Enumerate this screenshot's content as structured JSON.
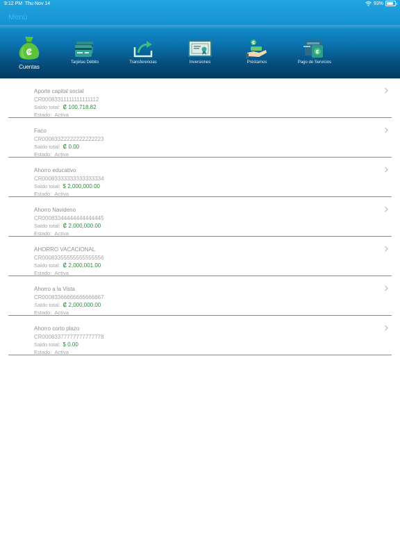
{
  "status_bar": {
    "time": "9:12 PM",
    "date": "Thu Nov 14",
    "battery": "93%"
  },
  "header": {
    "menu_label": "Menú",
    "colors": {
      "menu_link": "#3fb6ff",
      "header_top": "#22a6e2",
      "header_bottom": "#043c62"
    }
  },
  "nav": [
    {
      "label": "Cuentas",
      "icon": "money-bag-icon",
      "active": true
    },
    {
      "label": "Tarjetas Débito",
      "icon": "debit-card-icon",
      "active": false
    },
    {
      "label": "Transferencias",
      "icon": "transfer-arrow-icon",
      "active": false
    },
    {
      "label": "Inversiones",
      "icon": "certificate-icon",
      "active": false
    },
    {
      "label": "Préstamos",
      "icon": "loan-hand-icon",
      "active": false
    },
    {
      "label": "Pago de Servicios",
      "icon": "bill-payment-icon",
      "active": false
    }
  ],
  "labels": {
    "saldo": "Saldo total:",
    "estado": "Estado:"
  },
  "accounts": [
    {
      "name": "Aporte capital social",
      "number": "CR00083311111111111112",
      "balance": "₡ 100,718.82",
      "status": "Activa"
    },
    {
      "name": "Faco",
      "number": "CR00083322222222222223",
      "balance": "₡ 0.00",
      "status": "Activa"
    },
    {
      "name": "Ahorro educativo",
      "number": "CR00083333333333333334",
      "balance": "$ 2,000,000.00",
      "status": "Activa"
    },
    {
      "name": "Ahorro Navideno",
      "number": "CR00083344444444444445",
      "balance": "₡ 2,000,000.00",
      "status": "Activa"
    },
    {
      "name": "AHORRO VACACIONAL",
      "number": "CR00083355555555555556",
      "balance": "₡ 2,000,001.00",
      "status": "Activa"
    },
    {
      "name": "Ahorro a la Vista",
      "number": "CR00083366666666666667",
      "balance": "₡ 2,000,000.00",
      "status": "Activa"
    },
    {
      "name": "Ahorro corto plazo",
      "number": "CR00083377777777777778",
      "balance": "$ 0.00",
      "status": "Activa"
    }
  ],
  "colors": {
    "balance": "#2e8b3a",
    "divider": "#8a8a8a",
    "muted_text": "#a3a3a3"
  }
}
